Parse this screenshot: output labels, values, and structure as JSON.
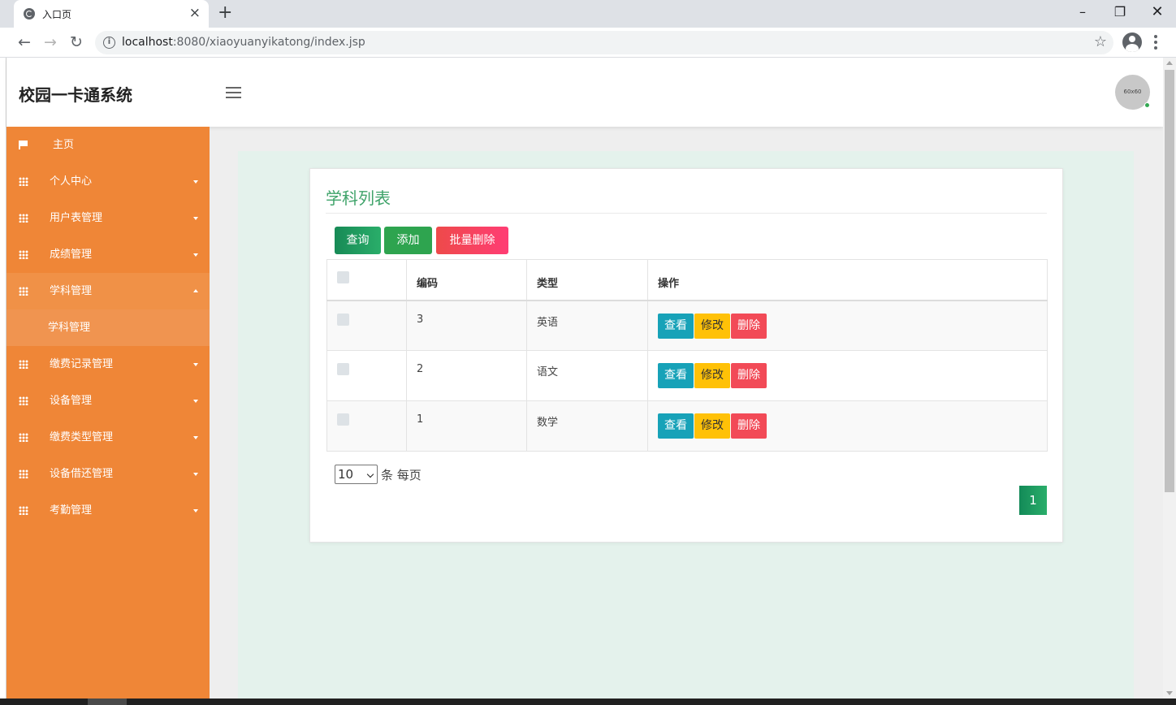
{
  "browser": {
    "tab_title": "入口页",
    "tab_close": "×",
    "new_tab": "+",
    "win_min": "–",
    "win_max": "❐",
    "win_close": "✕",
    "back": "←",
    "forward": "→",
    "reload": "↻",
    "url_host": "localhost",
    "url_path": ":8080/xiaoyuanyikatong/index.jsp",
    "info": "i",
    "star": "☆"
  },
  "app": {
    "brand": "校园一卡通系统",
    "avatar_text": "60x60"
  },
  "sidebar": {
    "items": [
      {
        "label": "主页",
        "icon": "flag-icon"
      },
      {
        "label": "个人中心",
        "icon": "grid-icon"
      },
      {
        "label": "用户表管理",
        "icon": "grid-icon"
      },
      {
        "label": "成绩管理",
        "icon": "grid-icon"
      },
      {
        "label": "学科管理",
        "icon": "grid-icon",
        "expanded": true
      },
      {
        "label": "缴费记录管理",
        "icon": "grid-icon"
      },
      {
        "label": "设备管理",
        "icon": "grid-icon"
      },
      {
        "label": "缴费类型管理",
        "icon": "grid-icon"
      },
      {
        "label": "设备借还管理",
        "icon": "grid-icon"
      },
      {
        "label": "考勤管理",
        "icon": "grid-icon"
      }
    ],
    "sub_item": "学科管理"
  },
  "main": {
    "title": "学科列表",
    "buttons": {
      "query": "查询",
      "add": "添加",
      "batch_delete": "批量删除"
    },
    "table": {
      "headers": [
        "",
        "编码",
        "类型",
        "操作"
      ],
      "rows": [
        {
          "code": "3",
          "type": "英语"
        },
        {
          "code": "2",
          "type": "语文"
        },
        {
          "code": "1",
          "type": "数学"
        }
      ],
      "actions": {
        "view": "查看",
        "edit": "修改",
        "delete": "删除"
      }
    },
    "pagination": {
      "page_size": "10",
      "per_page_label": "条 每页",
      "current_page": "1"
    }
  },
  "colors": {
    "sidebar_bg": "#ef8637",
    "title_green": "#3fa36a",
    "content_bg": "#e4f2ec",
    "view_btn": "#17a2b8",
    "edit_btn": "#ffc107",
    "delete_btn": "#f24a57"
  }
}
